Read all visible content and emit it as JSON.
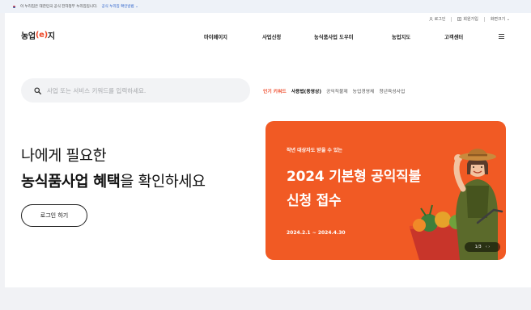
{
  "gov_bar": {
    "notice": "이 누리집은 대한민국 공식 전자정부 누리집입니다.",
    "link": "공식 누리집 확인방법 ⌄"
  },
  "util": {
    "login": "로그인",
    "signup": "회원가입",
    "font_size": "화면크기 ⌄"
  },
  "logo": {
    "prefix": "농업",
    "e": "(e)",
    "suffix": "지"
  },
  "nav": {
    "items": [
      "마이페이지",
      "사업신청",
      "농식품사업 도우미",
      "농업지도",
      "고객센터"
    ]
  },
  "search": {
    "placeholder": "사업 또는 서비스 키워드를 입력하세요."
  },
  "keywords": {
    "title": "인기 키워드",
    "items": [
      "사용법(동영상)",
      "공익직불제",
      "농업경영체",
      "청년육성사업"
    ]
  },
  "hero": {
    "line1": "나에게 필요한",
    "line2_bold": "농식품사업 혜택",
    "line2_rest": "을 확인하세요",
    "login_button": "로그인 하기"
  },
  "banner": {
    "subtitle": "작년 대상자도 받을 수 있는",
    "title_line1": "2024 기본형 공익직불",
    "title_line2": "신청 접수",
    "date": "2024.2.1 ~ 2024.4.30",
    "pager": "1/3",
    "pager_controls": "‹ ›",
    "colors": {
      "background": "#f15a24",
      "accent": "#ee4b2b"
    }
  }
}
